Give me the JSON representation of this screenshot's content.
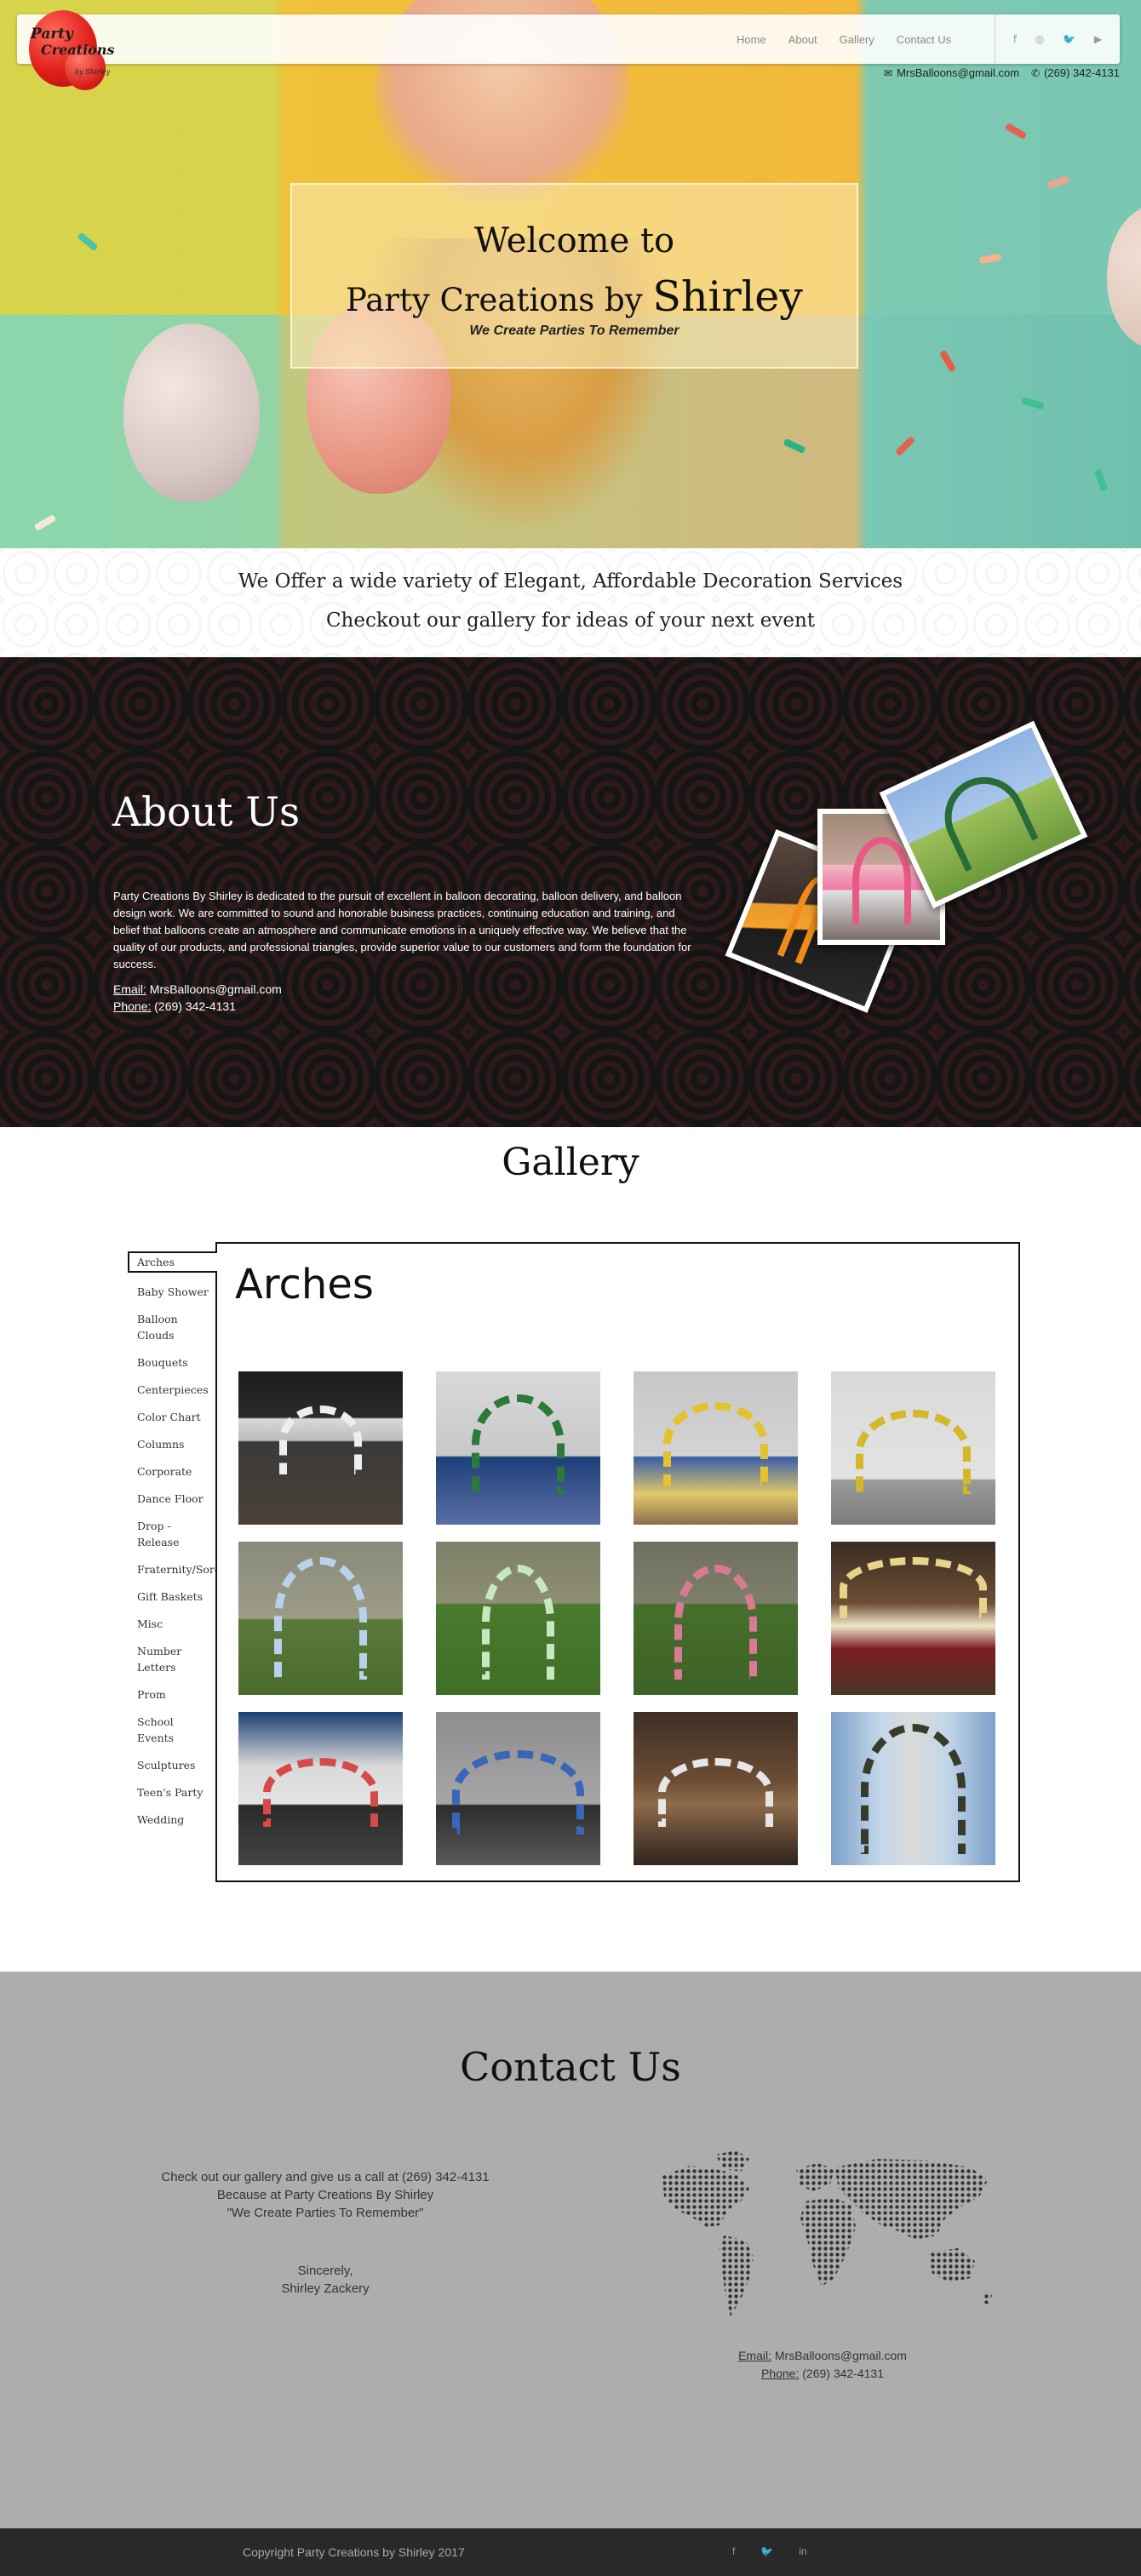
{
  "logo": {
    "line1": "Party",
    "line2": "Creations",
    "line3": "by Shirley"
  },
  "nav": {
    "links": [
      "Home",
      "About",
      "Gallery",
      "Contact Us"
    ],
    "social": [
      "f",
      "◎",
      "🐦",
      "▶"
    ]
  },
  "top_contact": {
    "email": "MrsBalloons@gmail.com",
    "phone": "(269) 342-4131"
  },
  "hero": {
    "line1": "Welcome to",
    "line2_prefix": "Party Creations by ",
    "line2_name": "Shirley",
    "tagline": "We Create Parties To Remember"
  },
  "offer": {
    "line1": "We Offer a wide variety of Elegant, Affordable Decoration Services",
    "line2": "Checkout our gallery for ideas of your next event"
  },
  "about": {
    "title": "About Us",
    "body": "Party Creations By Shirley is dedicated to the pursuit of excellent in balloon decorating, balloon delivery, and balloon design work. We are committed to sound and honorable business practices, continuing education and training, and belief that balloons create an atmosphere and communicate emotions in a uniquely effective way. We believe that the quality of our products, and professional triangles, provide superior value to our customers and form the foundation for success.",
    "email_label": "Email:",
    "email": "MrsBalloons@gmail.com",
    "phone_label": "Phone:",
    "phone": "(269) 342-4131"
  },
  "gallery": {
    "title": "Gallery",
    "active_category": "Arches",
    "categories": [
      "Arches",
      "Baby Shower",
      "Balloon Clouds",
      "Bouquets",
      "Centerpieces",
      "Color Chart",
      "Columns",
      "Corporate",
      "Dance Floor",
      "Drop - Release",
      "Fraternity/Sorority",
      "Gift Baskets",
      "Misc",
      "Number Letters",
      "Prom",
      "School Events",
      "Sculptures",
      "Teen's Party",
      "Wedding"
    ],
    "panel_title": "Arches"
  },
  "contact": {
    "title": "Contact Us",
    "line1": "Check out our gallery and give us a call at (269) 342-4131",
    "line2": "Because at Party Creations By Shirley",
    "line3": "\"We Create Parties To Remember\"",
    "line4": "Sincerely,",
    "line5": "Shirley Zackery",
    "email_label": "Email:",
    "email": "MrsBalloons@gmail.com",
    "phone_label": "Phone:",
    "phone": "(269) 342-4131"
  },
  "footer": {
    "copyright": "Copyright Party Creations by Shirley 2017",
    "social": [
      "f",
      "🐦",
      "in"
    ]
  }
}
